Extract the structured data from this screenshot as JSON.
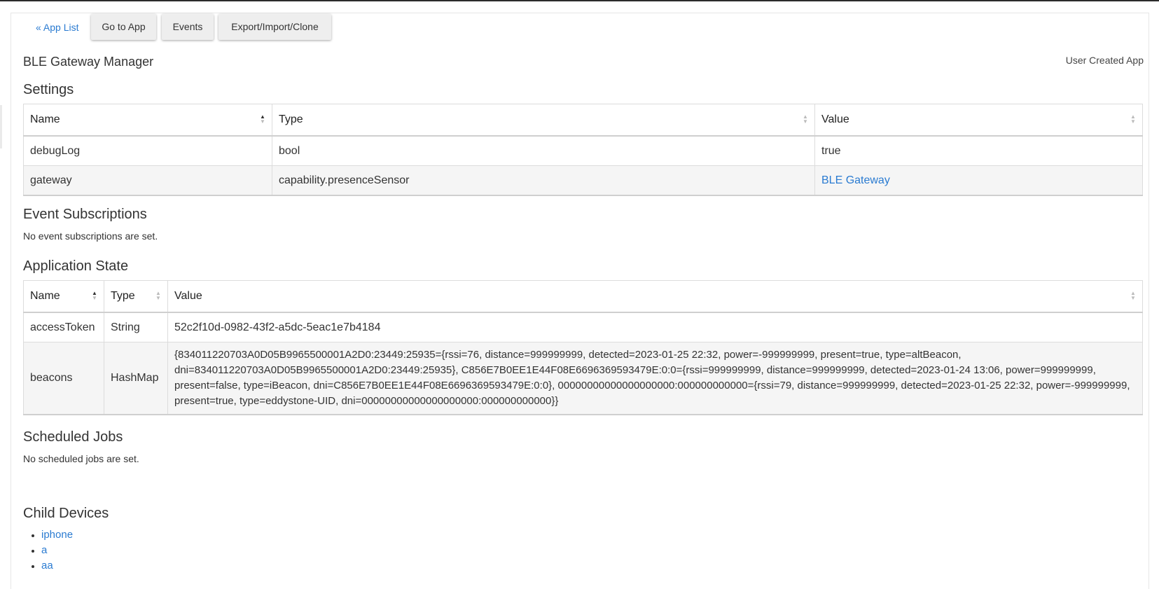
{
  "nav": {
    "app_list_link": "« App List",
    "go_to_app": "Go to App",
    "events": "Events",
    "export": "Export/Import/Clone"
  },
  "app": {
    "title": "BLE Gateway Manager",
    "type": "User Created App"
  },
  "settings": {
    "heading": "Settings",
    "columns": [
      "Name",
      "Type",
      "Value"
    ],
    "rows": [
      {
        "name": "debugLog",
        "type": "bool",
        "value": "true"
      },
      {
        "name": "gateway",
        "type": "capability.presenceSensor",
        "value": "BLE Gateway"
      }
    ]
  },
  "event_subscriptions": {
    "heading": "Event Subscriptions",
    "note": "No event subscriptions are set."
  },
  "application_state": {
    "heading": "Application State",
    "columns": [
      "Name",
      "Type",
      "Value"
    ],
    "rows": [
      {
        "name": "accessToken",
        "type": "String",
        "value": "52c2f10d-0982-43f2-a5dc-5eac1e7b4184"
      },
      {
        "name": "beacons",
        "type": "HashMap",
        "value": "{834011220703A0D05B9965500001A2D0:23449:25935={rssi=76, distance=999999999, detected=2023-01-25 22:32, power=-999999999, present=true, type=altBeacon, dni=834011220703A0D05B9965500001A2D0:23449:25935}, C856E7B0EE1E44F08E6696369593479E:0:0={rssi=999999999, distance=999999999, detected=2023-01-24 13:06, power=999999999, present=false, type=iBeacon, dni=C856E7B0EE1E44F08E6696369593479E:0:0}, 00000000000000000000:000000000000={rssi=79, distance=999999999, detected=2023-01-25 22:32, power=-999999999, present=true, type=eddystone-UID, dni=00000000000000000000:000000000000}}"
      }
    ]
  },
  "scheduled_jobs": {
    "heading": "Scheduled Jobs",
    "note": "No scheduled jobs are set."
  },
  "child_devices": {
    "heading": "Child Devices",
    "items": [
      "iphone",
      "a",
      "aa"
    ]
  },
  "colors": {
    "link": "#2a7bd1",
    "button_bg": "#eeeeee",
    "alt_row": "#f5f5f5"
  }
}
